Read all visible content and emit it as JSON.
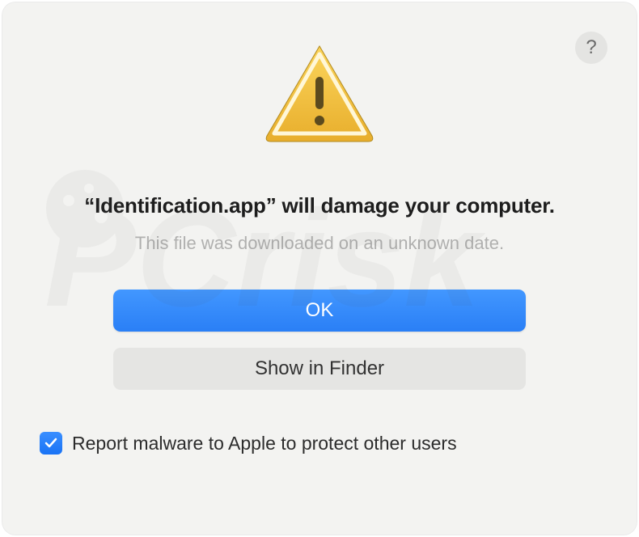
{
  "dialog": {
    "title": "“Identification.app” will damage your computer.",
    "subtitle": "This file was downloaded on an unknown date.",
    "primary_button": "OK",
    "secondary_button": "Show in Finder",
    "checkbox_label": "Report malware to Apple to protect other users",
    "checkbox_checked": true,
    "help_label": "?"
  },
  "colors": {
    "primary": "#2a7ff6",
    "background": "#f3f3f1"
  },
  "watermark": "PCrisk.com"
}
